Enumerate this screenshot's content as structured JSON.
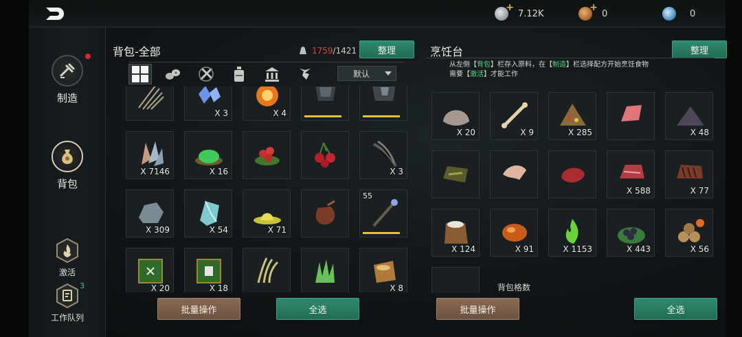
{
  "topbar": {
    "currencies": [
      {
        "name": "silver-coin",
        "value": "7.12K",
        "has_plus": true,
        "color": "#b9c1c4"
      },
      {
        "name": "copper-coin",
        "value": "0",
        "has_plus": true,
        "color": "#c98a43"
      },
      {
        "name": "gem-coin",
        "value": "0",
        "has_plus": false,
        "color": "#6ea9d4"
      }
    ]
  },
  "sidebar": {
    "items": [
      {
        "label": "制造",
        "icon": "craft-icon",
        "active": false,
        "has_red_dot": true
      },
      {
        "label": "背包",
        "icon": "bag-icon",
        "active": true
      },
      {
        "label": "激活",
        "icon": "fire-icon"
      },
      {
        "label": "工作队列",
        "icon": "queue-icon",
        "badge": "3"
      }
    ]
  },
  "bag": {
    "title": "背包-全部",
    "weight_current": "1759",
    "weight_max": "/1421",
    "sort_button": "整理",
    "dropdown_value": "默认",
    "filters": [
      "all-icon",
      "wood-icon",
      "tools-icon",
      "potion-icon",
      "building-icon",
      "trophy-icon"
    ],
    "batch_button": "批量操作",
    "select_all_button": "全选",
    "items": [
      {
        "icon": "thorns-icon",
        "qty": ""
      },
      {
        "icon": "blue-crystal-icon",
        "qty": "X 3"
      },
      {
        "icon": "fire-orb-icon",
        "qty": "X 4"
      },
      {
        "icon": "armor-icon",
        "qty": "",
        "durability": true
      },
      {
        "icon": "armor-dark-icon",
        "qty": "",
        "durability": true
      },
      {
        "icon": "crystal-cluster-icon",
        "qty": "X 7146"
      },
      {
        "icon": "green-powder-icon",
        "qty": "X 16"
      },
      {
        "icon": "red-berries-icon",
        "qty": ""
      },
      {
        "icon": "cherry-icon",
        "qty": ""
      },
      {
        "icon": "feathers-icon",
        "qty": "X 3"
      },
      {
        "icon": "stone-icon",
        "qty": "X 309"
      },
      {
        "icon": "ice-crystal-icon",
        "qty": "X 54"
      },
      {
        "icon": "yellow-slime-icon",
        "qty": "X 71"
      },
      {
        "icon": "leather-pouch-icon",
        "qty": ""
      },
      {
        "icon": "staff-icon",
        "qty": "",
        "level": "55",
        "durability": true
      },
      {
        "icon": "green-book-icon",
        "qty": "X 20"
      },
      {
        "icon": "green-book-2-icon",
        "qty": "X 18"
      },
      {
        "icon": "straw-icon",
        "qty": ""
      },
      {
        "icon": "grass-icon",
        "qty": ""
      },
      {
        "icon": "seed-sack-icon",
        "qty": "X 8"
      }
    ]
  },
  "cooking": {
    "title": "烹饪台",
    "sort_button": "整理",
    "instructions": {
      "p1": "从左侧【",
      "bag": "背包",
      "p2": "】栏存入原料，在【",
      "craft": "制造",
      "p3": "】栏选择配方开始烹饪食物",
      "p4": "需要【",
      "activate": "激活",
      "p5": "】才能工作"
    },
    "batch_button": "批量操作",
    "select_all_button": "全选",
    "capacity_label": "背包格数",
    "items": [
      {
        "icon": "shell-icon",
        "qty": "X 20"
      },
      {
        "icon": "bone-icon",
        "qty": "X 9"
      },
      {
        "icon": "spice-mix-icon",
        "qty": "X 285"
      },
      {
        "icon": "raw-meat-icon",
        "qty": ""
      },
      {
        "icon": "dark-powder-icon",
        "qty": "X 48"
      },
      {
        "icon": "herb-board-icon",
        "qty": ""
      },
      {
        "icon": "chicken-wing-icon",
        "qty": ""
      },
      {
        "icon": "red-meat-icon",
        "qty": ""
      },
      {
        "icon": "marbled-meat-icon",
        "qty": "X 588"
      },
      {
        "icon": "grilled-steak-icon",
        "qty": "X 77"
      },
      {
        "icon": "flour-sack-icon",
        "qty": "X 124"
      },
      {
        "icon": "amber-icon",
        "qty": "X 91"
      },
      {
        "icon": "green-flame-icon",
        "qty": "X 1153"
      },
      {
        "icon": "berries-leaf-icon",
        "qty": "X 443"
      },
      {
        "icon": "firewood-icon",
        "qty": "X 56"
      },
      {
        "icon": "pink-item-icon",
        "qty": ""
      }
    ]
  }
}
